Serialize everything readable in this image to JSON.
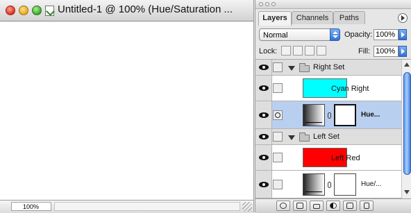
{
  "document": {
    "title": "Untitled-1 @ 100% (Hue/Saturation ...",
    "zoom": "100%"
  },
  "palette": {
    "tabs": [
      {
        "label": "Layers",
        "active": true
      },
      {
        "label": "Channels",
        "active": false
      },
      {
        "label": "Paths",
        "active": false
      }
    ],
    "blend_mode": "Normal",
    "opacity_label": "Opacity:",
    "opacity_value": "100%",
    "lock_label": "Lock:",
    "fill_label": "Fill:",
    "fill_value": "100%",
    "layers": [
      {
        "type": "set",
        "name": "Right Set",
        "visible": true
      },
      {
        "type": "fill",
        "name": "Cyan Right",
        "color": "#00ffff",
        "visible": true
      },
      {
        "type": "adjustment",
        "name": "Hue...",
        "visible": true,
        "selected": true
      },
      {
        "type": "set",
        "name": "Left Set",
        "visible": true
      },
      {
        "type": "fill",
        "name": "Left Red",
        "color": "#ff0000",
        "visible": true
      },
      {
        "type": "adjustment",
        "name": "Hue/...",
        "visible": true,
        "selected": false
      }
    ]
  },
  "colors": {
    "selection": "#b9cfef",
    "cyan": "#00ffff",
    "red": "#ff0000",
    "aqua_blue": "#3e7ce0"
  },
  "icons": [
    "close-icon",
    "minimize-icon",
    "zoom-icon",
    "document-proxy-icon",
    "palette-menu-icon",
    "eye-icon",
    "folder-icon",
    "layer-mask-icon",
    "link-chain-icon",
    "new-layer-icon",
    "delete-icon",
    "layer-style-icon",
    "new-set-icon",
    "adjustment-layer-icon"
  ]
}
